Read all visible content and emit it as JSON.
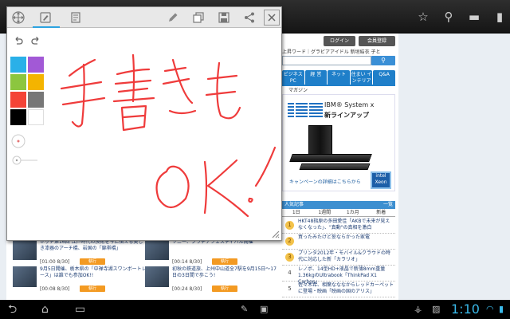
{
  "header": {
    "login_label": "ログイン",
    "register_label": "会員登録",
    "search_links": "上昇ワード｜グラビアアイドル 新垣結衣 子と",
    "search_button_icon": "search-icon"
  },
  "nav": {
    "tabs": [
      "ビジネス PC",
      "経 営",
      "ネット",
      "住まい インテリア",
      "Q&A"
    ],
    "magazine": "マガジン"
  },
  "ad": {
    "logo": "IBM",
    "title": "IBM® System x",
    "subtitle": "新ラインアップ",
    "detail": "キャンペーンの詳細はこちらから",
    "badge": "intel Xeon"
  },
  "ranking": {
    "title": "人気記事",
    "period": "一覧",
    "tabs": [
      "1日",
      "1週間",
      "1カ月",
      "新着"
    ],
    "items": [
      {
        "num": "1",
        "text": "HKT48指原の多田愛佳「AKBで未来が見えなくなった」、\"真動\"の真相を激白"
      },
      {
        "num": "2",
        "text": "買ったみたけど妄ならかった家電"
      },
      {
        "num": "3",
        "text": "プリンタ2012年・モバイル&クラウドの時代に対応した新「カラリオ」"
      },
      {
        "num": "4",
        "text": "レノボ、14型HD+液晶で新薄8mm重量1.36kgのUltrabook「ThinkPad X1 Carbon」"
      },
      {
        "num": "5",
        "text": "佐々木希、相葉なななからレッドカーペットに登場・映画「映画の国のアリス」"
      }
    ]
  },
  "articles": [
    {
      "text": "ホッチ第16回 江戸時代の技術を今に伝える美しき漆器のアーチ橋、岩国の「錦帯橋」",
      "date": "[01:00 8/30]",
      "button": "執行"
    },
    {
      "text": "9月5日開催、栃木県の「中禅寺湖スワンボートレース」は誰でも参加OK!!",
      "date": "[00:08 8/30]",
      "button": "執行"
    },
    {
      "text": "ソニー、プラチナフェスティバル開催",
      "date": "[00:14 8/30]",
      "button": "執行"
    },
    {
      "text": "初秋の鉄道旅、上州中山道全7駅を9月15日～17日の3日間で歩こう!",
      "date": "[00:24 8/30]",
      "button": "執行"
    }
  ],
  "memo": {
    "toolbar_icons": [
      "move-icon",
      "pen-mode-icon",
      "text-mode-icon",
      "edit-icon",
      "copy-icon",
      "save-icon",
      "share-icon",
      "close-icon"
    ],
    "palette_colors": [
      "#2ab0e8",
      "#a259d6",
      "#8cc63f",
      "#f4b400",
      "#f44336",
      "#777777",
      "#000000",
      "#ffffff"
    ],
    "ink_color": "#ef3b3b",
    "handwriting": "手書きもOK!"
  },
  "status_bar": {
    "time": "1:10",
    "clock_color": "#3ab8e8"
  }
}
